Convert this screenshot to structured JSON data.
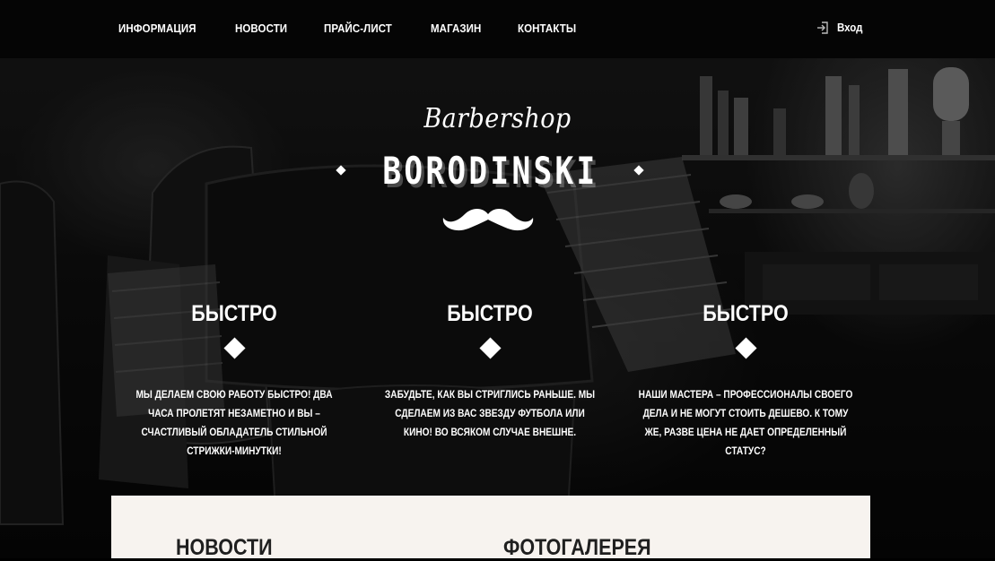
{
  "nav": {
    "items": [
      "ИНФОРМАЦИЯ",
      "НОВОСТИ",
      "ПРАЙС-ЛИСТ",
      "МАГАЗИН",
      "КОНТАКТЫ"
    ],
    "login_label": "Вход",
    "login_icon": "login-icon"
  },
  "hero": {
    "logo_script": "Barbershop",
    "logo_main": "BORODINSKI",
    "logo_icon": "mustache-icon",
    "features": [
      {
        "title": "БЫСТРО",
        "text": "Мы делаем свою работу быстро! Два часа пролетят незаметно и вы – счастливый обладатель стильной стрижки-минутки!"
      },
      {
        "title": "БЫСТРО",
        "text": "Забудьте, как вы стриглись раньше. Мы сделаем из вас звезду футбола или кино! Во всяком случае внешне."
      },
      {
        "title": "БЫСТРО",
        "text": "Наши мастера – профессионалы своего дела и не могут стоить дешево. К тому же, разве цена не дает определенный статус?"
      }
    ]
  },
  "panel": {
    "news_title": "НОВОСТИ",
    "gallery_title": "ФОТОГАЛЕРЕЯ"
  },
  "colors": {
    "topbar": "#050505",
    "panel": "#f7f3ef",
    "panel_text": "#1f1f1f"
  }
}
